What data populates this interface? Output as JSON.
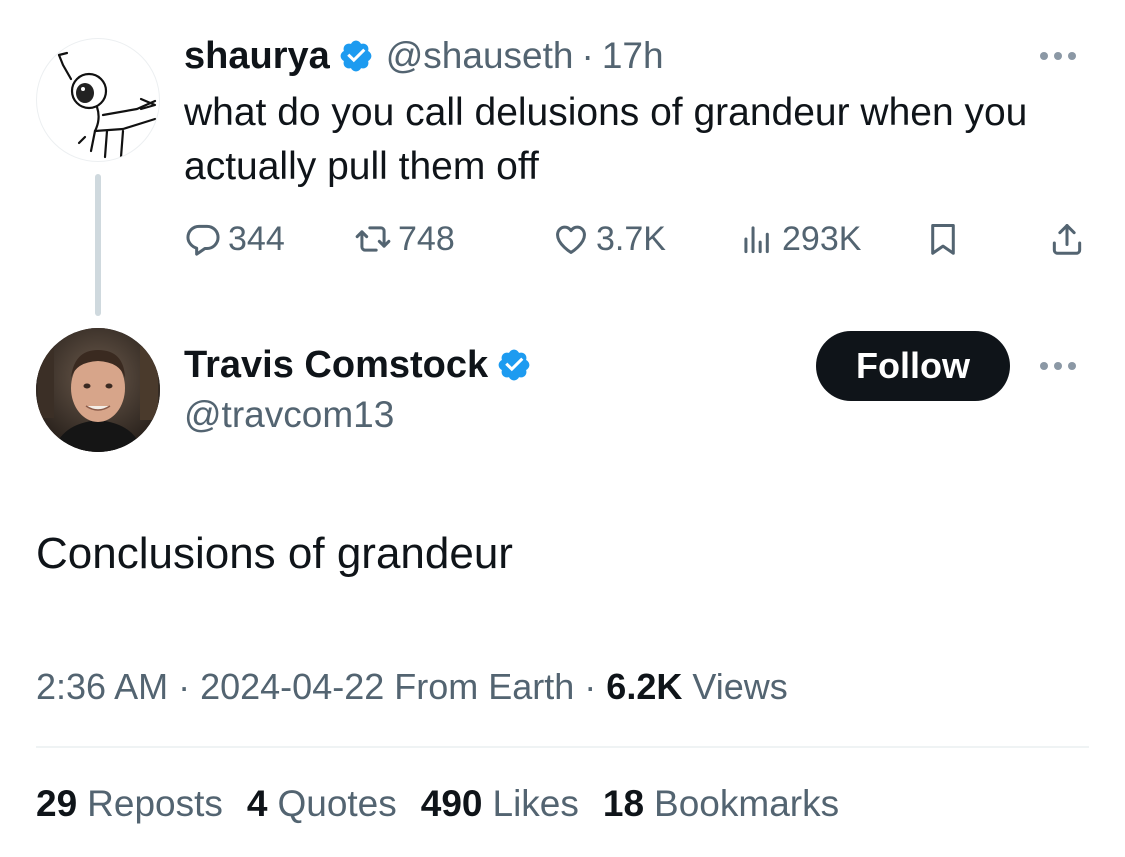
{
  "parent_tweet": {
    "author_name": "shaurya",
    "author_handle": "@shauseth",
    "separator": "·",
    "time_ago": "17h",
    "text": "what do you call delusions of grandeur when you actually pull them off",
    "avatar_icon": "stick-figure-drawing-avatar",
    "verified_icon": "verified-badge-icon",
    "metrics": {
      "replies": "344",
      "reposts": "748",
      "likes": "3.7K",
      "views": "293K"
    }
  },
  "reply_tweet": {
    "author_name": "Travis Comstock",
    "author_handle": "@travcom13",
    "follow_label": "Follow",
    "text": "Conclusions of grandeur",
    "time": "2:36 AM",
    "date": "2024-04-22",
    "source": "From Earth",
    "views_count": "6.2K",
    "views_label": "Views",
    "separator": "·",
    "stats": {
      "reposts_count": "29",
      "reposts_label": "Reposts",
      "quotes_count": "4",
      "quotes_label": "Quotes",
      "likes_count": "490",
      "likes_label": "Likes",
      "bookmarks_count": "18",
      "bookmarks_label": "Bookmarks"
    }
  },
  "colors": {
    "text_primary": "#0f1419",
    "text_secondary": "#536471",
    "verified_blue": "#1d9bf0",
    "follow_button_bg": "#0f1419",
    "thread_line": "#cfd9de"
  }
}
